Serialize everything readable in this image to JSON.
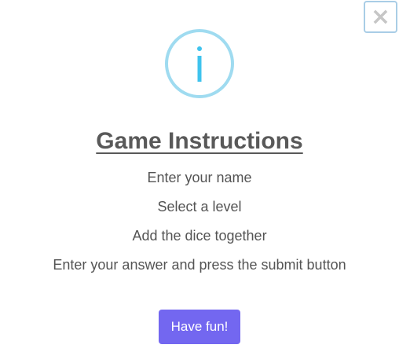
{
  "dialog": {
    "close_label": "×",
    "icon": "info-icon",
    "title": "Game Instructions",
    "instructions": [
      "Enter your name",
      "Select a level",
      "Add the dice together",
      "Enter your answer and press the submit button"
    ],
    "confirm_label": "Have fun!"
  },
  "colors": {
    "icon_ring": "#9fdbf0",
    "icon_glyph": "#3fc3ee",
    "title": "#595959",
    "text": "#545454",
    "confirm_button": "#7367f0",
    "close_border": "#a9cde6",
    "close_glyph": "#c6c6c6"
  }
}
